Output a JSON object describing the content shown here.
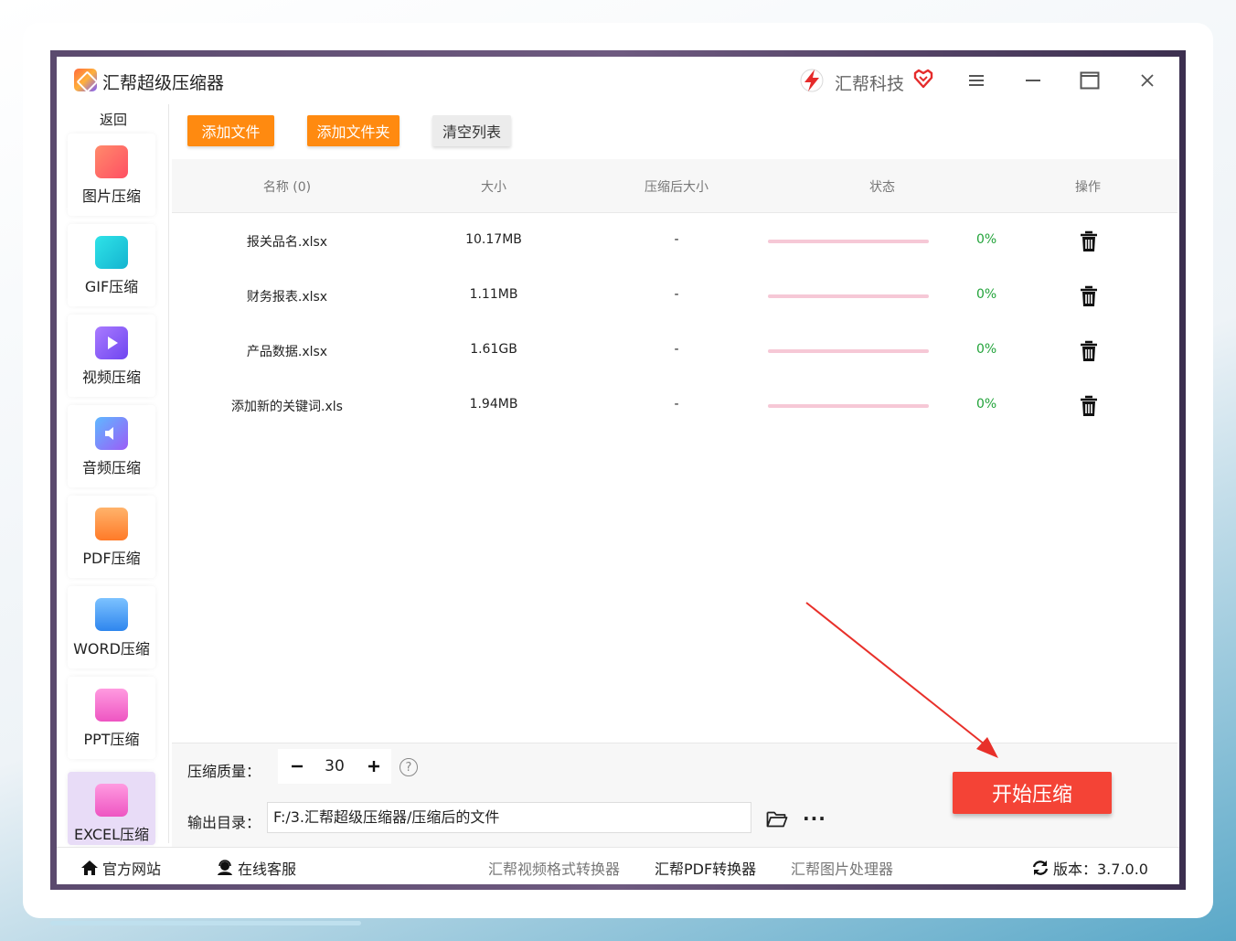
{
  "app": {
    "title": "汇帮超级压缩器",
    "brand": "汇帮科技",
    "accent": "#ff8a10",
    "start_color": "#f44336"
  },
  "titlebar": {
    "icons": [
      "menu-icon",
      "minimize-icon",
      "maximize-icon",
      "close-icon"
    ]
  },
  "sidebar": {
    "back_label": "返回",
    "items": [
      {
        "label": "图片压缩",
        "icon": "image-icon",
        "color": "#ff6f61"
      },
      {
        "label": "GIF压缩",
        "icon": "gif-icon",
        "color": "#1ec9d6"
      },
      {
        "label": "视频压缩",
        "icon": "video-icon",
        "color": "#8a5cf7"
      },
      {
        "label": "音频压缩",
        "icon": "audio-icon",
        "color": "#6a7cf8"
      },
      {
        "label": "PDF压缩",
        "icon": "pdf-icon",
        "color": "#ff8a3d"
      },
      {
        "label": "WORD压缩",
        "icon": "word-icon",
        "color": "#3d9df5"
      },
      {
        "label": "PPT压缩",
        "icon": "ppt-icon",
        "color": "#f066c8"
      },
      {
        "label": "EXCEL压缩",
        "icon": "excel-icon",
        "color": "#f066c8"
      }
    ],
    "active_index": 7
  },
  "toolbar": {
    "add_file": "添加文件",
    "add_folder": "添加文件夹",
    "clear_list": "清空列表"
  },
  "table": {
    "headers": [
      "名称 (0)",
      "大小",
      "压缩后大小",
      "状态",
      "操作"
    ],
    "rows": [
      {
        "name": "报关品名.xlsx",
        "size": "10.17MB",
        "compressed": "-",
        "progress": 0,
        "percent": "0%"
      },
      {
        "name": "财务报表.xlsx",
        "size": "1.11MB",
        "compressed": "-",
        "progress": 0,
        "percent": "0%"
      },
      {
        "name": "产品数据.xlsx",
        "size": "1.61GB",
        "compressed": "-",
        "progress": 0,
        "percent": "0%"
      },
      {
        "name": "添加新的关键词.xls",
        "size": "1.94MB",
        "compressed": "-",
        "progress": 0,
        "percent": "0%"
      }
    ]
  },
  "settings": {
    "quality_label": "压缩质量：",
    "quality_value": "30",
    "output_label": "输出目录：",
    "output_path": "F:/3.汇帮超级压缩器/压缩后的文件",
    "more": "···"
  },
  "start_button": "开始压缩",
  "footer": {
    "website": "官方网站",
    "support": "在线客服",
    "link1": "汇帮视频格式转换器",
    "link2": "汇帮PDF转换器",
    "link3": "汇帮图片处理器",
    "version": "版本：3.7.0.0"
  }
}
